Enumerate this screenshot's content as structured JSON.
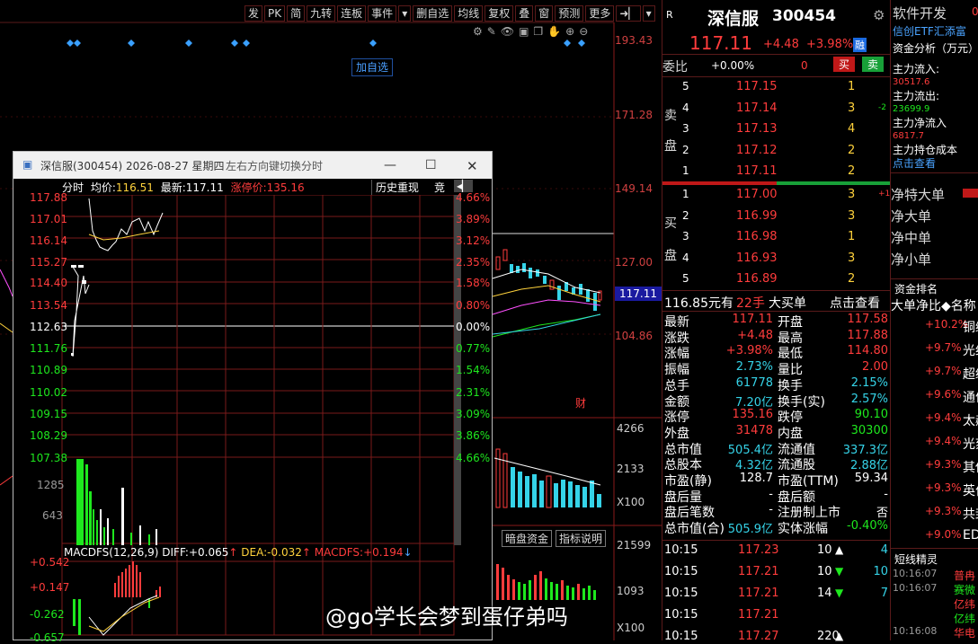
{
  "toolbar": [
    "发",
    "PK",
    "简",
    "九转",
    "连板",
    "事件",
    "▾",
    "删自选",
    "均线",
    "复权",
    "叠",
    "窗",
    "预测",
    "更多",
    "➜▏",
    "▾"
  ],
  "chart": {
    "price_ticks": [
      "193.43",
      "171.28",
      "149.14",
      "127.00",
      "104.86"
    ],
    "current_price": "117.11",
    "vol_ticks": [
      "4266",
      "2133",
      "X100"
    ],
    "macd_ticks": [
      "21599",
      "1093",
      "X100"
    ],
    "add_watch": "加自选",
    "cai_label": "财",
    "tabs": {
      "dark_fund": "暗盘资金",
      "indicator_desc": "指标说明"
    }
  },
  "popup": {
    "title": "深信服(300454) 2026-08-27 星期四",
    "hint": "左右方向键切换分时",
    "bar": {
      "mode": "分时",
      "avg_label": "均价:",
      "avg": "116.51",
      "latest_label": "最新:",
      "latest": "117.11",
      "limit_label": "涨停价:",
      "limit": "135.16",
      "history": "历史重现",
      "jing": "竞"
    },
    "left_ticks": [
      "117.88",
      "117.01",
      "116.14",
      "115.27",
      "114.40",
      "113.54",
      "112.63",
      "111.76",
      "110.89",
      "110.02",
      "109.15",
      "108.29",
      "107.38"
    ],
    "right_ticks": [
      "4.66%",
      "3.89%",
      "3.12%",
      "2.35%",
      "1.58%",
      "0.80%",
      "0.00%",
      "0.77%",
      "1.54%",
      "2.31%",
      "3.09%",
      "3.86%",
      "4.66%"
    ],
    "vol_ticks": [
      "1285",
      "643"
    ],
    "macd_header": {
      "name": "MACDFS(12,26,9)",
      "diff_label": "DIFF:",
      "diff": "+0.065",
      "dea_label": "DEA:",
      "dea": "-0.032",
      "macdfs_label": "MACDFS:",
      "macdfs": "+0.194"
    },
    "macd_ticks": [
      "+0.542",
      "+0.147",
      "-0.262",
      "-0.657"
    ]
  },
  "quote": {
    "r": "R",
    "name": "深信服",
    "code": "300454",
    "price": "117.11",
    "change": "+4.48",
    "pct": "+3.98%",
    "badge": "融",
    "ratio_label": "委比",
    "ratio": "+0.00%",
    "ratio_diff": "0",
    "buy": "买",
    "sell": "卖",
    "asks": [
      {
        "n": "5",
        "p": "117.15",
        "v": "1",
        "x": ""
      },
      {
        "n": "4",
        "p": "117.14",
        "v": "3",
        "x": "-2"
      },
      {
        "n": "3",
        "p": "117.13",
        "v": "4",
        "x": ""
      },
      {
        "n": "2",
        "p": "117.12",
        "v": "2",
        "x": ""
      },
      {
        "n": "1",
        "p": "117.11",
        "v": "2",
        "x": ""
      }
    ],
    "bids": [
      {
        "n": "1",
        "p": "117.00",
        "v": "3",
        "x": "+1"
      },
      {
        "n": "2",
        "p": "116.99",
        "v": "3",
        "x": ""
      },
      {
        "n": "3",
        "p": "116.98",
        "v": "1",
        "x": ""
      },
      {
        "n": "4",
        "p": "116.93",
        "v": "3",
        "x": ""
      },
      {
        "n": "5",
        "p": "116.89",
        "v": "2",
        "x": ""
      }
    ],
    "ask_label": [
      "卖",
      "盘"
    ],
    "bid_label": [
      "买",
      "盘"
    ],
    "big": {
      "price": "116.85元有",
      "qty": "22手",
      "label": "大买单",
      "link": "点击查看"
    },
    "stats": [
      {
        "l1": "最新",
        "v1": "117.11",
        "c1": "red",
        "l2": "开盘",
        "v2": "117.58",
        "c2": "red"
      },
      {
        "l1": "涨跌",
        "v1": "+4.48",
        "c1": "red",
        "l2": "最高",
        "v2": "117.88",
        "c2": "red"
      },
      {
        "l1": "涨幅",
        "v1": "+3.98%",
        "c1": "red",
        "l2": "最低",
        "v2": "114.80",
        "c2": "red"
      },
      {
        "l1": "振幅",
        "v1": "2.73%",
        "c1": "cyan",
        "l2": "量比",
        "v2": "2.00",
        "c2": "red"
      },
      {
        "l1": "总手",
        "v1": "61778",
        "c1": "cyan",
        "l2": "换手",
        "v2": "2.15%",
        "c2": "cyan"
      },
      {
        "l1": "金额",
        "v1": "7.20亿",
        "c1": "cyan",
        "l2": "换手(实)",
        "v2": "2.57%",
        "c2": "cyan"
      },
      {
        "l1": "涨停",
        "v1": "135.16",
        "c1": "red",
        "l2": "跌停",
        "v2": "90.10",
        "c2": "green"
      },
      {
        "l1": "外盘",
        "v1": "31478",
        "c1": "red",
        "l2": "内盘",
        "v2": "30300",
        "c2": "green"
      },
      {
        "l1": "总市值",
        "v1": "505.4亿",
        "c1": "cyan",
        "l2": "流通值",
        "v2": "337.3亿",
        "c2": "cyan"
      },
      {
        "l1": "总股本",
        "v1": "4.32亿",
        "c1": "cyan",
        "l2": "流通股",
        "v2": "2.88亿",
        "c2": "cyan"
      },
      {
        "l1": "市盈(静)",
        "v1": "128.7",
        "c1": "white",
        "l2": "市盈(TTM)",
        "v2": "59.34",
        "c2": "white"
      },
      {
        "l1": "盘后量",
        "v1": "-",
        "c1": "white",
        "l2": "盘后额",
        "v2": "-",
        "c2": "white"
      },
      {
        "l1": "盘后笔数",
        "v1": "-",
        "c1": "white",
        "l2": "注册制上市",
        "v2": "否",
        "c2": "white"
      },
      {
        "l1": "总市值(合)",
        "v1": "505.9亿",
        "c1": "cyan",
        "l2": "实体涨幅",
        "v2": "-0.40%",
        "c2": "green"
      }
    ],
    "ticks": [
      {
        "t": "10:15",
        "p": "117.23",
        "v": "10",
        "d": "up",
        "n": "4"
      },
      {
        "t": "10:15",
        "p": "117.21",
        "v": "10",
        "d": "down",
        "n": "10"
      },
      {
        "t": "10:15",
        "p": "117.21",
        "v": "14",
        "d": "down",
        "n": "7"
      },
      {
        "t": "10:15",
        "p": "117.21",
        "v": "",
        "d": "",
        "n": ""
      },
      {
        "t": "10:15",
        "p": "117.27",
        "v": "220",
        "d": "up",
        "n": ""
      }
    ]
  },
  "side": {
    "dev": "软件开发",
    "dev_val": "0",
    "etf": "信创ETF汇添富",
    "fund_title": "资金分析（万元）",
    "in_label": "主力流入:",
    "in_val": "30517.6",
    "out_label": "主力流出:",
    "out_val": "23699.9",
    "net_label": "主力净流入",
    "net_val": "6817.7",
    "cost_label": "主力持仓成本",
    "cost_link": "点击查看",
    "legend": [
      "净特大单",
      "净大单",
      "净中单",
      "净小单"
    ],
    "rank_title": "资金排名",
    "rank_cols": "大单净比◆名称",
    "ranks": [
      {
        "p": "+10.2%",
        "n": "铜缆"
      },
      {
        "p": "+9.7%",
        "n": "光纤"
      },
      {
        "p": "+9.7%",
        "n": "超级"
      },
      {
        "p": "+9.6%",
        "n": "通信"
      },
      {
        "p": "+9.4%",
        "n": "太赫"
      },
      {
        "p": "+9.4%",
        "n": "光刻"
      },
      {
        "p": "+9.3%",
        "n": "其他"
      },
      {
        "p": "+9.3%",
        "n": "英伟"
      },
      {
        "p": "+9.3%",
        "n": "共封"
      },
      {
        "p": "+9.0%",
        "n": "EDA"
      }
    ],
    "news_title": "短线精灵",
    "news": [
      {
        "t": "10:16:07",
        "n": "普冉"
      },
      {
        "t": "10:16:07",
        "n": "赛微"
      },
      {
        "t": "",
        "n": "亿纬"
      },
      {
        "t": "",
        "n": "亿纬"
      },
      {
        "t": "10:16:08",
        "n": "华电"
      }
    ]
  },
  "watermark": "@go学长会梦到蛋仔弟吗"
}
